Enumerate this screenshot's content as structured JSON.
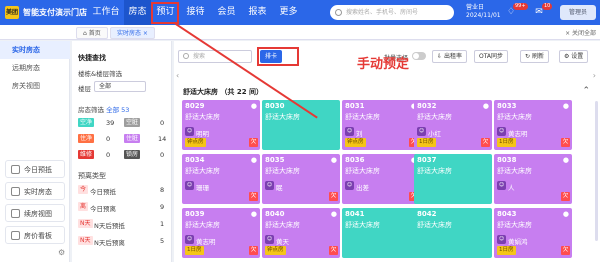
{
  "topbar": {
    "logo": "美团",
    "store_name": "智能支付演示门店",
    "nav": [
      {
        "label": "工作台"
      },
      {
        "label": "房态"
      },
      {
        "label": "预订"
      },
      {
        "label": "接待"
      },
      {
        "label": "会员"
      },
      {
        "label": "报表"
      },
      {
        "label": "更多"
      }
    ],
    "search_placeholder": "搜索姓名、手机号、房间号",
    "biz_label": "营业日",
    "biz_date": "2024/11/01",
    "bell_badge": "99+",
    "msg_badge": "10",
    "user": "管理员"
  },
  "tabs": [
    {
      "label": "首页"
    },
    {
      "label": "实时房态"
    }
  ],
  "tabs_close": "× 关闭全部",
  "sidebar": {
    "items": [
      {
        "label": "实时房态"
      },
      {
        "label": "远期房态"
      },
      {
        "label": "房关视图"
      }
    ],
    "buttons": [
      {
        "label": "今日预抵"
      },
      {
        "label": "实时房态"
      },
      {
        "label": "续房视图"
      },
      {
        "label": "房价看板"
      }
    ]
  },
  "filter": {
    "title": "快捷查找",
    "floor_filter_label": "楼栋&楼层筛选",
    "floor_label": "楼层",
    "floor_value": "全部",
    "status_filter_label": "房态筛选",
    "status_total": "全部 53",
    "statuses": [
      {
        "label": "空净",
        "count": "39",
        "color": "#40d6c4"
      },
      {
        "label": "空脏",
        "count": "0",
        "color": "#9e9e9e"
      },
      {
        "label": "住净",
        "count": "0",
        "color": "#ff7043"
      },
      {
        "label": "住脏",
        "count": "14",
        "color": "#c77ef0"
      },
      {
        "label": "维修",
        "count": "0",
        "color": "#e53935"
      },
      {
        "label": "锁房",
        "count": "0",
        "color": "#555555"
      }
    ],
    "reserve_title": "预离类型",
    "reserve": [
      {
        "tag": "今",
        "label": "今日预抵",
        "count": "8"
      },
      {
        "tag": "离",
        "label": "今日预离",
        "count": "9"
      },
      {
        "tag": "N天",
        "label": "N天后预抵",
        "count": "1"
      },
      {
        "tag": "N天",
        "label": "N天后预离",
        "count": "5"
      }
    ]
  },
  "main": {
    "search_placeholder": "搜索",
    "batch_btn": "排卡",
    "toggle_label": "批量选择",
    "btn_print": "出租率",
    "btn_ota": "OTA同步",
    "btn_refresh": "刷新",
    "btn_settings": "设置",
    "annotation": "手动预定",
    "section_title": "舒适大床房 （共 22 间）",
    "rooms": [
      {
        "num": "8029",
        "type": "舒适大床房",
        "color": "purple",
        "guest": "明明",
        "tag": "钟点房",
        "badge": "欠"
      },
      {
        "num": "8030",
        "type": "舒适大床房",
        "color": "teal",
        "guest": "",
        "tag": "",
        "badge": ""
      },
      {
        "num": "8031",
        "type": "舒适大床房",
        "color": "purple",
        "guest": "刘",
        "tag": "钟点房",
        "badge": "欠"
      },
      {
        "num": "8032",
        "type": "舒适大床房",
        "color": "purple",
        "guest": "小红",
        "tag": "1日房",
        "badge": "欠"
      },
      {
        "num": "8033",
        "type": "舒适大床房",
        "color": "purple",
        "guest": "黄志明",
        "tag": "1日房",
        "badge": "欠"
      },
      {
        "num": "8034",
        "type": "舒适大床房",
        "color": "purple",
        "guest": "珊珊",
        "tag": "",
        "badge": "欠"
      },
      {
        "num": "8035",
        "type": "舒适大床房",
        "color": "purple",
        "guest": "眠",
        "tag": "",
        "badge": "欠"
      },
      {
        "num": "8036",
        "type": "舒适大床房",
        "color": "purple",
        "guest": "出差",
        "tag": "",
        "badge": "欠"
      },
      {
        "num": "8037",
        "type": "舒适大床房",
        "color": "teal",
        "guest": "",
        "tag": "",
        "badge": ""
      },
      {
        "num": "8038",
        "type": "舒适大床房",
        "color": "purple",
        "guest": "人",
        "tag": "",
        "badge": "欠"
      },
      {
        "num": "8039",
        "type": "舒适大床房",
        "color": "purple",
        "guest": "黄志明",
        "tag": "1日房",
        "badge": "欠"
      },
      {
        "num": "8040",
        "type": "舒适大床房",
        "color": "purple",
        "guest": "黄天",
        "tag": "钟点房",
        "badge": "欠"
      },
      {
        "num": "8041",
        "type": "舒适大床房",
        "color": "teal",
        "guest": "",
        "tag": "",
        "badge": ""
      },
      {
        "num": "8042",
        "type": "舒适大床房",
        "color": "teal",
        "guest": "",
        "tag": "",
        "badge": ""
      },
      {
        "num": "8043",
        "type": "舒适大床房",
        "color": "purple",
        "guest": "黄娟鸿",
        "tag": "1日房",
        "badge": "欠"
      }
    ]
  },
  "colors": {
    "brand": "#2b67e8",
    "occupied": "#c77ef0",
    "vacant": "#40d6c4",
    "highlight": "#e53935"
  }
}
